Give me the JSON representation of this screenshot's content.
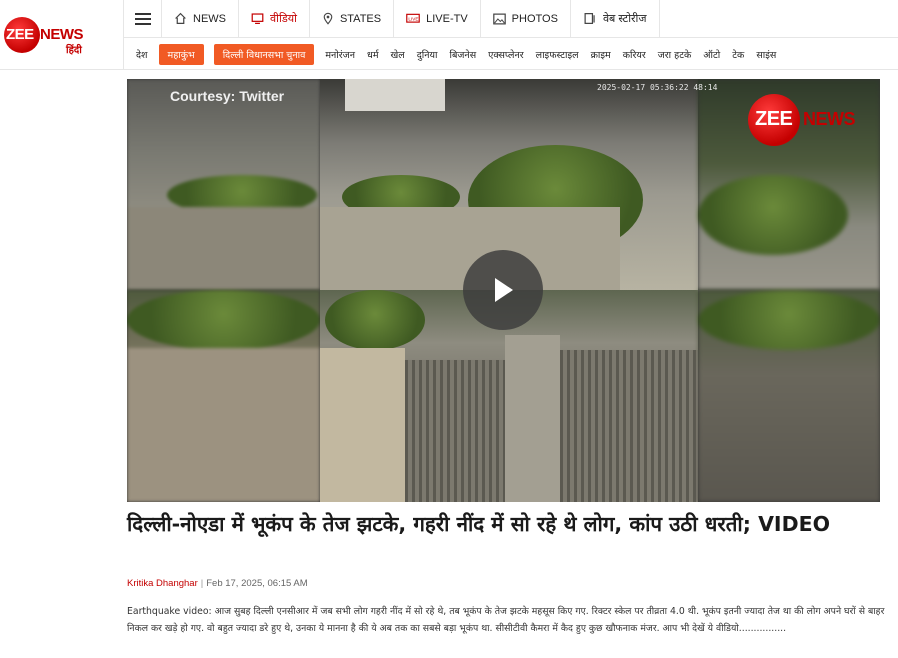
{
  "logo": {
    "brand_red": "ZEE",
    "brand_dark": "NEWS",
    "sub": "हिंदी",
    "brand_color": "#c40000"
  },
  "topnav": {
    "items": [
      {
        "label": "NEWS",
        "icon": "home-icon",
        "red": false
      },
      {
        "label": "वीडियो",
        "icon": "monitor-icon",
        "red": true
      },
      {
        "label": "STATES",
        "icon": "location-pin-icon",
        "red": false
      },
      {
        "label": "LIVE-TV",
        "icon": "live-tv-icon",
        "red": false
      },
      {
        "label": "PHOTOS",
        "icon": "photo-icon",
        "red": false
      },
      {
        "label": "वेब स्टोरीज",
        "icon": "web-stories-icon",
        "red": false
      }
    ]
  },
  "subnav": {
    "items": [
      "देश",
      "महाकुंभ",
      "दिल्ली विधानसभा चुनाव",
      "मनोरंजन",
      "धर्म",
      "खेल",
      "दुनिया",
      "बिजनेस",
      "एक्सप्लेनर",
      "लाइफस्टाइल",
      "क्राइम",
      "करियर",
      "जरा हटके",
      "ऑटो",
      "टेक",
      "साइंस"
    ],
    "highlight_color": "#f15a24"
  },
  "video": {
    "courtesy": "Courtesy: Twitter",
    "timestamp": "2025-02-17 05:36:22 48:14",
    "watermark": "ZEE NEWS",
    "play_icon": "play-icon"
  },
  "article": {
    "headline": "दिल्ली-नोएडा में भूकंप के तेज झटके, गहरी नींद में सो रहे थे लोग, कांप उठी धरती; VIDEO",
    "author": "Kritika Dhanghar",
    "date": "Feb 17, 2025, 06:15 AM",
    "excerpt": "Earthquake video: आज सुबह दिल्ली एनसीआर में जब सभी लोग गहरी नींद में सो रहे थे, तब भूकंप के तेज झटके महसूस किए गए. रिक्टर स्केल पर तीव्रता 4.0 थी. भूकंप इतनी ज्यादा तेज था की लोग अपने घरों से बाहर निकल कर खड़े हो गए. वो बहुत ज्यादा डरे हुए थे, उनका ये मानना है की ये अब तक का सबसे बड़ा भूकंप था. सीसीटीवी कैमरा में कैद हुए कुछ खौफनाक मंजर. आप भी देखें ये वीडियो................"
  }
}
